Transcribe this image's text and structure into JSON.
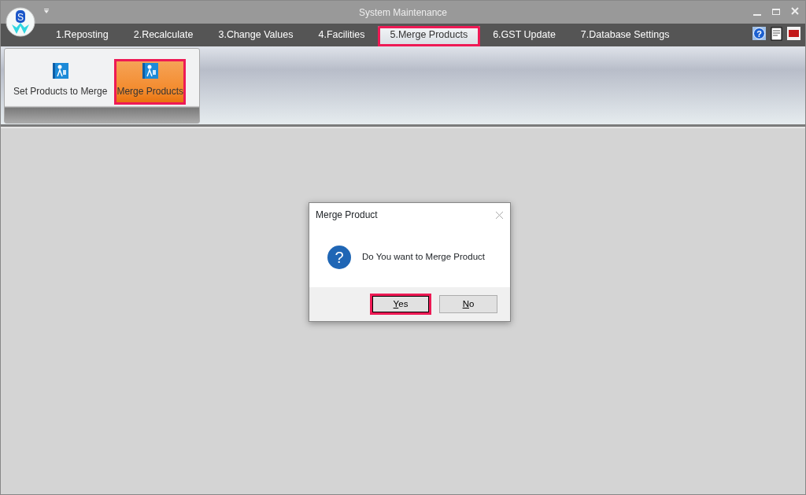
{
  "window": {
    "title": "System Maintenance",
    "logo_letter": "S",
    "help_glyph": "?"
  },
  "tabs": [
    {
      "label": "1.Reposting",
      "selected": false
    },
    {
      "label": "2.Recalculate",
      "selected": false
    },
    {
      "label": "3.Change Values",
      "selected": false
    },
    {
      "label": "4.Facilities",
      "selected": false
    },
    {
      "label": "5.Merge Products",
      "selected": true,
      "highlighted": true
    },
    {
      "label": "6.GST Update",
      "selected": false
    },
    {
      "label": "7.Database Settings",
      "selected": false
    }
  ],
  "ribbon": {
    "buttons": [
      {
        "label": "Set Products to Merge",
        "selected": false,
        "highlighted": false
      },
      {
        "label": "Merge Products",
        "selected": true,
        "highlighted": true
      }
    ]
  },
  "dialog": {
    "title": "Merge Product",
    "icon_glyph": "?",
    "message": "Do You want to Merge Product",
    "buttons": [
      {
        "mnemonic": "Y",
        "label_rest": "es",
        "focused": true,
        "highlighted": true
      },
      {
        "mnemonic": "N",
        "label_rest": "o",
        "focused": false,
        "highlighted": false
      }
    ]
  }
}
